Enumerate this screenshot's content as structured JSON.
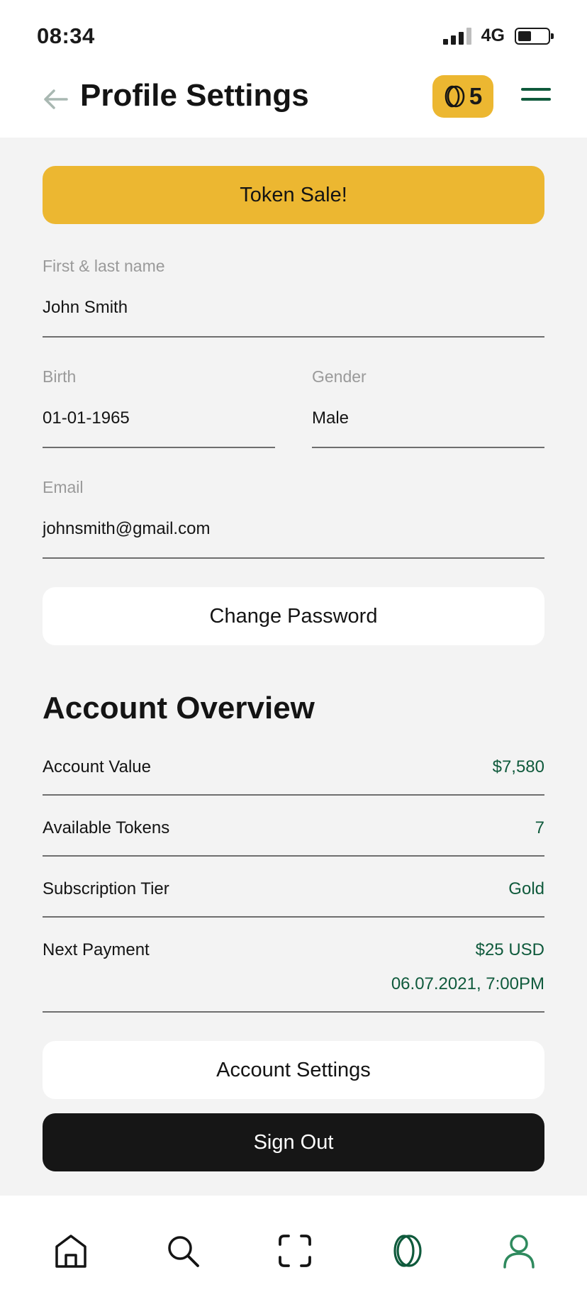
{
  "status": {
    "time": "08:34",
    "network": "4G"
  },
  "header": {
    "title": "Profile Settings",
    "token_count": "5"
  },
  "promo": {
    "label": "Token Sale!"
  },
  "profile": {
    "name_label": "First & last name",
    "name_value": "John Smith",
    "birth_label": "Birth",
    "birth_value": "01-01-1965",
    "gender_label": "Gender",
    "gender_value": "Male",
    "email_label": "Email",
    "email_value": "johnsmith@gmail.com"
  },
  "change_password": {
    "label": "Change Password"
  },
  "overview": {
    "title": "Account Overview",
    "rows": [
      {
        "label": "Account Value",
        "value": "$7,580"
      },
      {
        "label": "Available Tokens",
        "value": "7"
      },
      {
        "label": "Subscription Tier",
        "value": "Gold"
      },
      {
        "label": "Next Payment",
        "value": "$25 USD",
        "value2": "06.07.2021, 7:00PM"
      }
    ]
  },
  "actions": {
    "account_settings": "Account Settings",
    "sign_out": "Sign Out"
  },
  "bottom_nav": {
    "items": [
      {
        "icon": "home-icon"
      },
      {
        "icon": "search-icon"
      },
      {
        "icon": "scan-icon"
      },
      {
        "icon": "token-icon"
      },
      {
        "icon": "profile-icon",
        "active": true
      }
    ]
  },
  "colors": {
    "accent": "#ecb731",
    "brand_green": "#0f5a3c",
    "background": "#f3f3f3",
    "dark_button": "#161616"
  }
}
